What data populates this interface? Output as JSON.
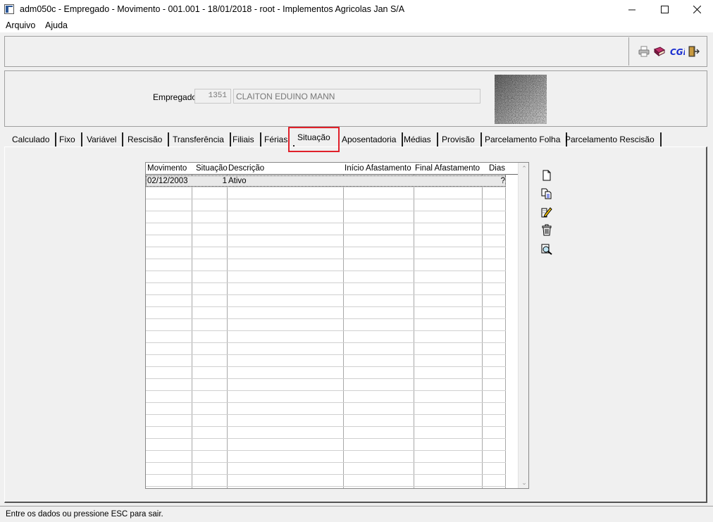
{
  "window": {
    "title": "adm050c - Empregado - Movimento - 001.001 - 18/01/2018 - root - Implementos Agricolas Jan S/A",
    "minimize_symbol": "—",
    "maximize_symbol": "☐",
    "close_symbol": "✕"
  },
  "menu": {
    "items": [
      "Arquivo",
      "Ajuda"
    ]
  },
  "toolbar": {
    "icons": [
      "printer-icon",
      "book-icon",
      "cgi-icon",
      "exit-door-icon"
    ],
    "cgi_label": "CGi"
  },
  "employee": {
    "label": "Empregado:",
    "code": "1351",
    "name": "CLAITON EDUINO MANN"
  },
  "tabs": {
    "items": [
      "Calculado",
      "Fixo",
      "Variável",
      "Rescisão",
      "Transferência",
      "Filiais",
      "Férias",
      "Situação",
      "Aposentadoria",
      "Médias",
      "Provisão",
      "Parcelamento Folha",
      "Parcelamento Rescisão"
    ],
    "active": "Situação"
  },
  "grid": {
    "columns": [
      "Movimento",
      "Situação",
      "Descrição",
      "Início Afastamento",
      "Final Afastamento",
      "Dias"
    ],
    "rows": [
      {
        "movimento": "02/12/2003",
        "situacao": "1",
        "descricao": "Ativo",
        "inicio": "",
        "final": "",
        "dias": "?"
      }
    ],
    "scroll_up": "⌃",
    "scroll_down": "⌄"
  },
  "side_actions": [
    "new-record-icon",
    "copy-record-icon",
    "edit-record-icon",
    "delete-record-icon",
    "search-record-icon"
  ],
  "status": {
    "text": "Entre os dados ou pressione ESC para sair."
  },
  "colors": {
    "highlight": "#e0202a",
    "selected_row": "#e8e8e8",
    "cgi_blue": "#1a2fd0"
  }
}
